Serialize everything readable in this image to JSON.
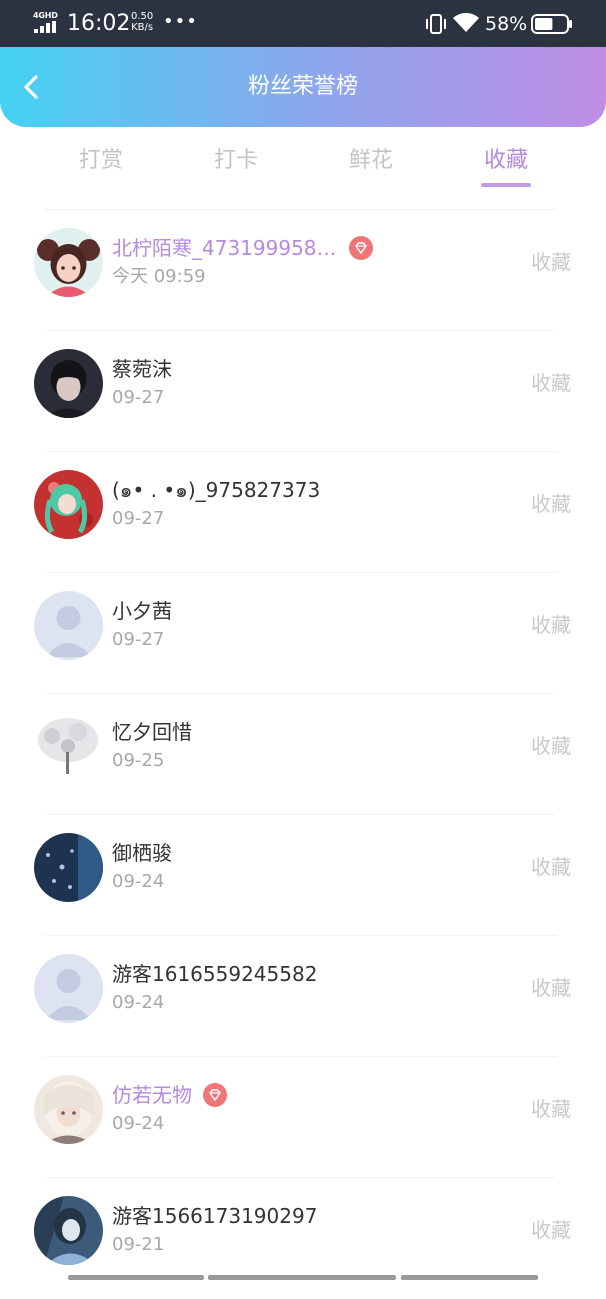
{
  "status_bar": {
    "network": "4GHD",
    "time": "16:02",
    "speed_value": "0.50",
    "speed_unit": "KB/s",
    "dots": "•••",
    "battery": "58%",
    "battery_level": 0.58
  },
  "header": {
    "title": "粉丝荣誉榜",
    "back_icon": "chevron-left-icon",
    "gradient": [
      "#44d2f3",
      "#bf8ee6"
    ]
  },
  "tabs": [
    {
      "label": "打赏",
      "active": false
    },
    {
      "label": "打卡",
      "active": false
    },
    {
      "label": "鲜花",
      "active": false
    },
    {
      "label": "收藏",
      "active": true
    }
  ],
  "accent_color": "#b68adb",
  "fans": [
    {
      "name": "北柠陌寒_473199958…",
      "date": "今天 09:59",
      "vip": true,
      "action": "收藏",
      "avatar": "anime-girl-avatar"
    },
    {
      "name": "蔡菀沫",
      "date": "09-27",
      "vip": false,
      "action": "收藏",
      "avatar": "dark-portrait-avatar"
    },
    {
      "name": "(๑• . •๑)_975827373",
      "date": "09-27",
      "vip": false,
      "action": "收藏",
      "avatar": "green-hair-avatar"
    },
    {
      "name": "小夕茜",
      "date": "09-27",
      "vip": false,
      "action": "收藏",
      "avatar": "default-user-avatar"
    },
    {
      "name": "忆夕回惜",
      "date": "09-25",
      "vip": false,
      "action": "收藏",
      "avatar": "white-tree-avatar"
    },
    {
      "name": "御栖骏",
      "date": "09-24",
      "vip": false,
      "action": "收藏",
      "avatar": "night-blue-avatar"
    },
    {
      "name": "游客1616559245582",
      "date": "09-24",
      "vip": false,
      "action": "收藏",
      "avatar": "default-user-avatar"
    },
    {
      "name": "仿若无物",
      "date": "09-24",
      "vip": true,
      "action": "收藏",
      "avatar": "anime-girl-avatar"
    },
    {
      "name": "游客1566173190297",
      "date": "09-21",
      "vip": false,
      "action": "收藏",
      "avatar": "blue-anime-avatar"
    }
  ]
}
